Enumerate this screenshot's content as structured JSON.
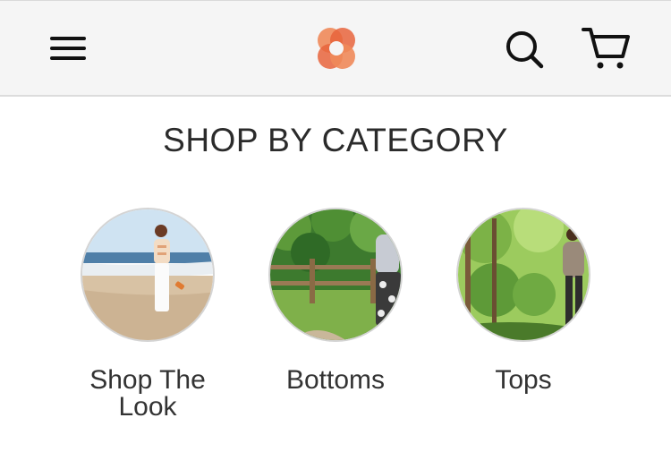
{
  "header": {
    "menu_icon": "hamburger-menu-icon",
    "logo_icon": "flower-logo-icon",
    "search_icon": "search-icon",
    "cart_icon": "shopping-cart-icon",
    "logo_colors": [
      "#e8643c",
      "#f09a6a"
    ]
  },
  "section": {
    "title": "SHOP BY CATEGORY"
  },
  "categories": [
    {
      "label": "Shop The Look"
    },
    {
      "label": "Bottoms"
    },
    {
      "label": "Tops"
    }
  ]
}
